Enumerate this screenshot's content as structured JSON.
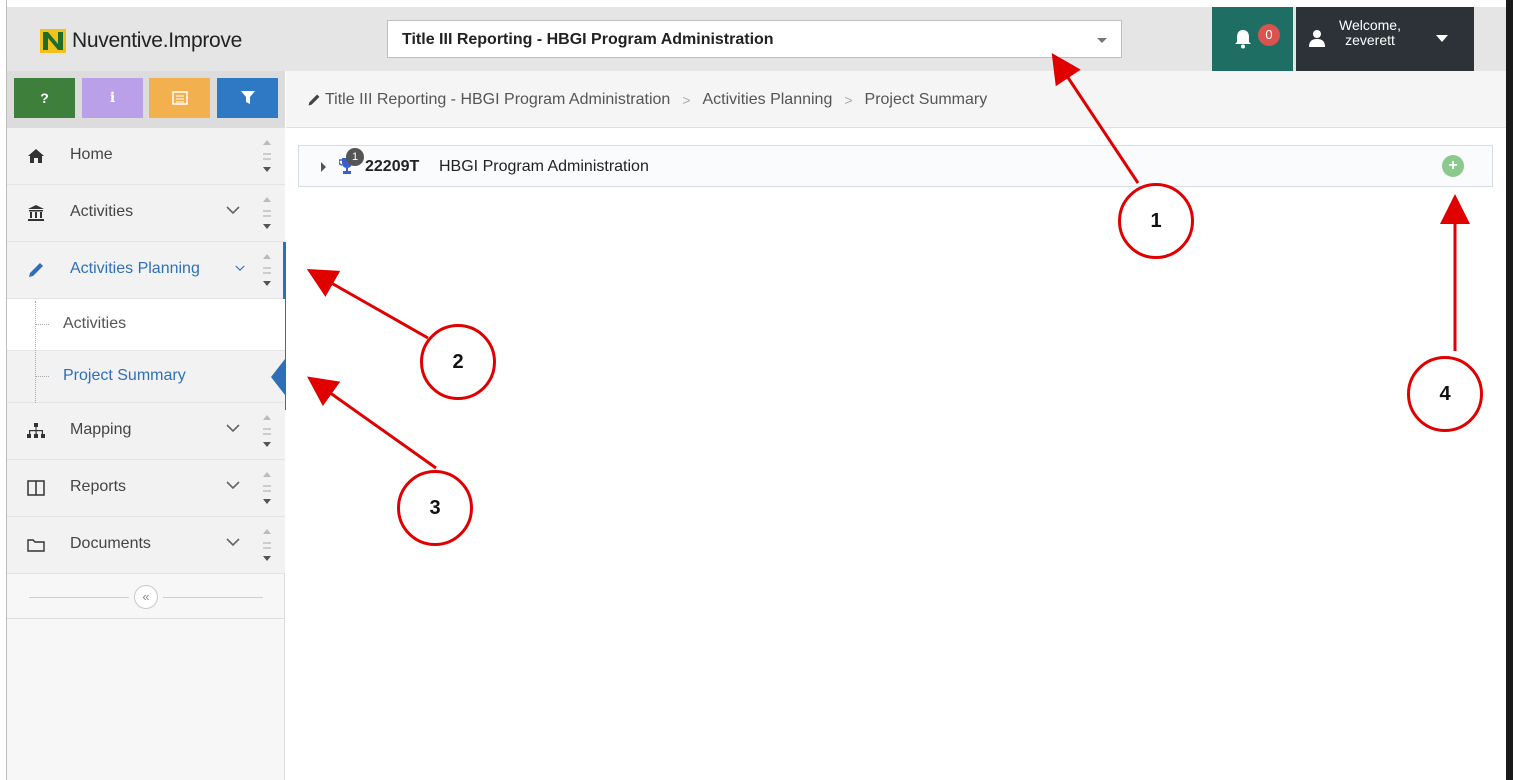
{
  "header": {
    "logo_brand": "Nuventive",
    "logo_product": "Improve",
    "program_select": "Title III Reporting - HBGI Program Administration",
    "notification_count": "0",
    "welcome_line1": "Welcome,",
    "welcome_line2": "zeverett"
  },
  "toolbar": {
    "buttons": [
      {
        "label": "?",
        "color": "#3f7f3c"
      },
      {
        "label": "i",
        "color": "#b9a0e8"
      },
      {
        "label": "≣",
        "color": "#f2b04f"
      },
      {
        "label": "filter",
        "color": "#2f78c4"
      }
    ]
  },
  "sidebar": {
    "items": [
      {
        "label": "Home",
        "icon": "home-icon"
      },
      {
        "label": "Activities",
        "icon": "institution-icon"
      },
      {
        "label": "Activities Planning",
        "icon": "pencil-icon"
      },
      {
        "label": "Mapping",
        "icon": "sitemap-icon"
      },
      {
        "label": "Reports",
        "icon": "columns-icon"
      },
      {
        "label": "Documents",
        "icon": "folder-icon"
      }
    ],
    "subitems": [
      {
        "label": "Activities"
      },
      {
        "label": "Project Summary"
      }
    ],
    "collapse_label": "«"
  },
  "breadcrumb": {
    "items": [
      "Title III Reporting - HBGI Program Administration",
      "Activities Planning",
      "Project Summary"
    ]
  },
  "project": {
    "badge_count": "1",
    "id": "22209T",
    "name": "HBGI Program Administration",
    "add_label": "+"
  },
  "callouts": [
    "1",
    "2",
    "3",
    "4"
  ]
}
